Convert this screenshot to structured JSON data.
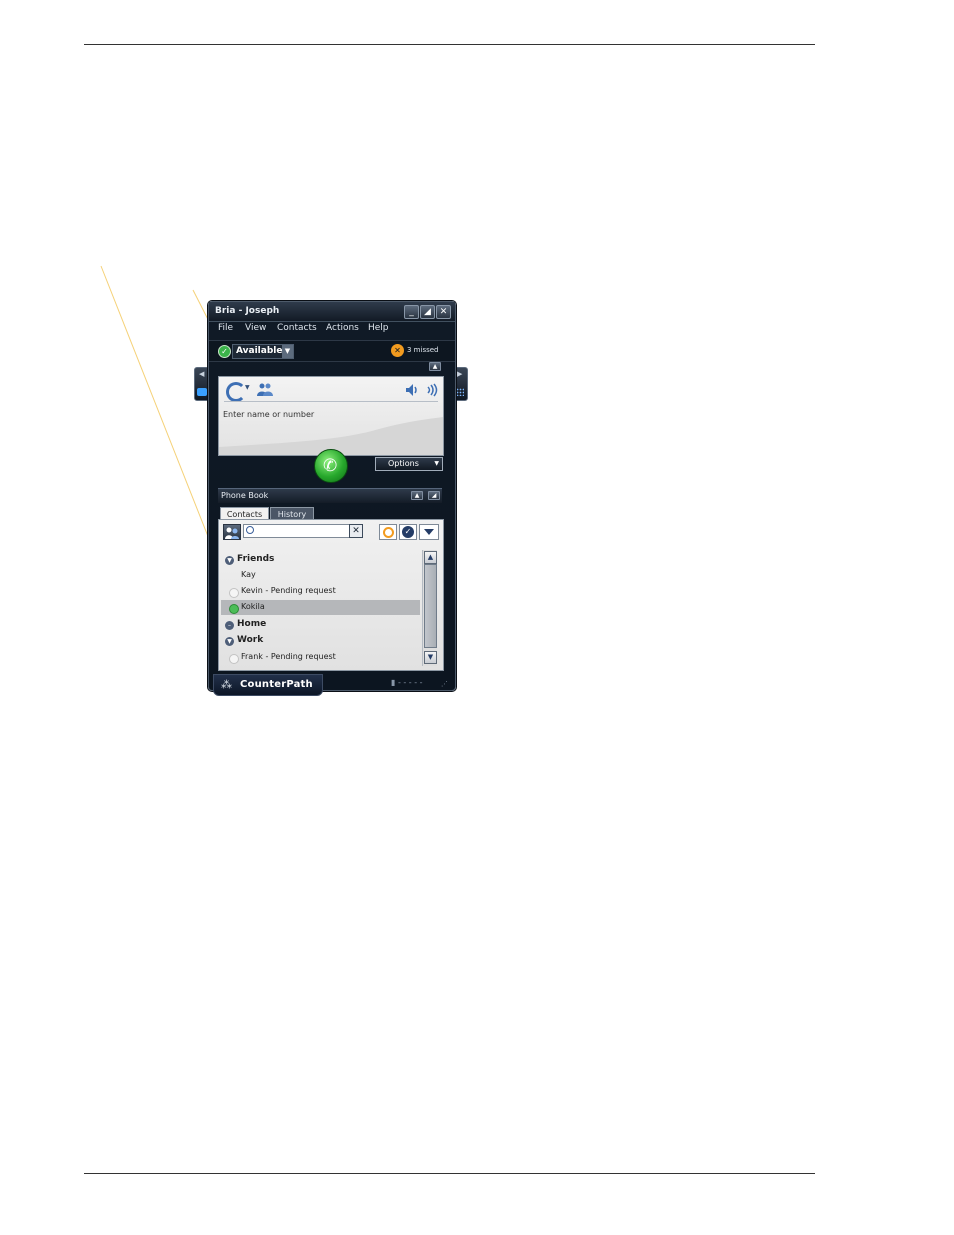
{
  "window": {
    "title": "Bria - Joseph",
    "menu": [
      "File",
      "View",
      "Contacts",
      "Actions",
      "Help"
    ],
    "status": "Available",
    "missed": "3 missed"
  },
  "dialer": {
    "placeholder": "Enter name or number",
    "options_label": "Options"
  },
  "phonebook": {
    "title": "Phone Book",
    "tabs": [
      "Contacts",
      "History"
    ],
    "groups": [
      {
        "label": "Friends",
        "expanded": true
      },
      {
        "label": "Home",
        "expanded": false
      },
      {
        "label": "Work",
        "expanded": true
      }
    ],
    "contacts": [
      {
        "label": "Kay",
        "presence": "none",
        "group": "Friends"
      },
      {
        "label": "Kevin - Pending request",
        "presence": "pending",
        "group": "Friends"
      },
      {
        "label": "Kokila",
        "presence": "online",
        "group": "Friends",
        "selected": true
      },
      {
        "label": "Frank - Pending request",
        "presence": "pending",
        "group": "Work"
      }
    ]
  },
  "brand": {
    "name": "CounterPath"
  },
  "colors": {
    "accent_available": "#3bb34a",
    "missed_orange": "#f29b1f",
    "callout_line": "#f5d178"
  }
}
